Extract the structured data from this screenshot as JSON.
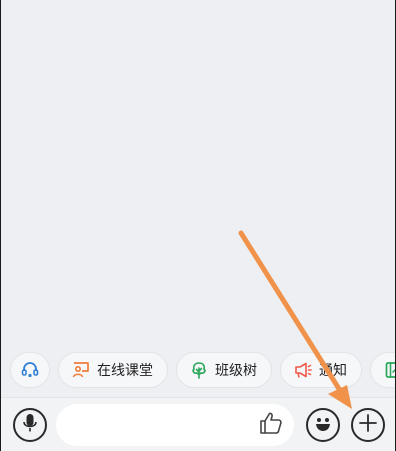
{
  "quick_actions": [
    {
      "label": "",
      "icon": "headset-icon"
    },
    {
      "label": "在线课堂",
      "icon": "online-class-icon"
    },
    {
      "label": "班级树",
      "icon": "tree-icon"
    },
    {
      "label": "通知",
      "icon": "megaphone-icon"
    },
    {
      "label": "",
      "icon": "notebook-icon"
    }
  ],
  "input": {
    "value": "",
    "placeholder": ""
  },
  "icons": {
    "voice": "microphone-icon",
    "like": "thumbs-up-icon",
    "emoji": "emoji-icon",
    "more": "plus-icon"
  },
  "colors": {
    "headset": "#2f80d6",
    "online_class": "#f07a3a",
    "tree": "#2aa65a",
    "megaphone": "#f05a4a",
    "notebook": "#2aa65a",
    "annotation_arrow": "#f0924a"
  }
}
